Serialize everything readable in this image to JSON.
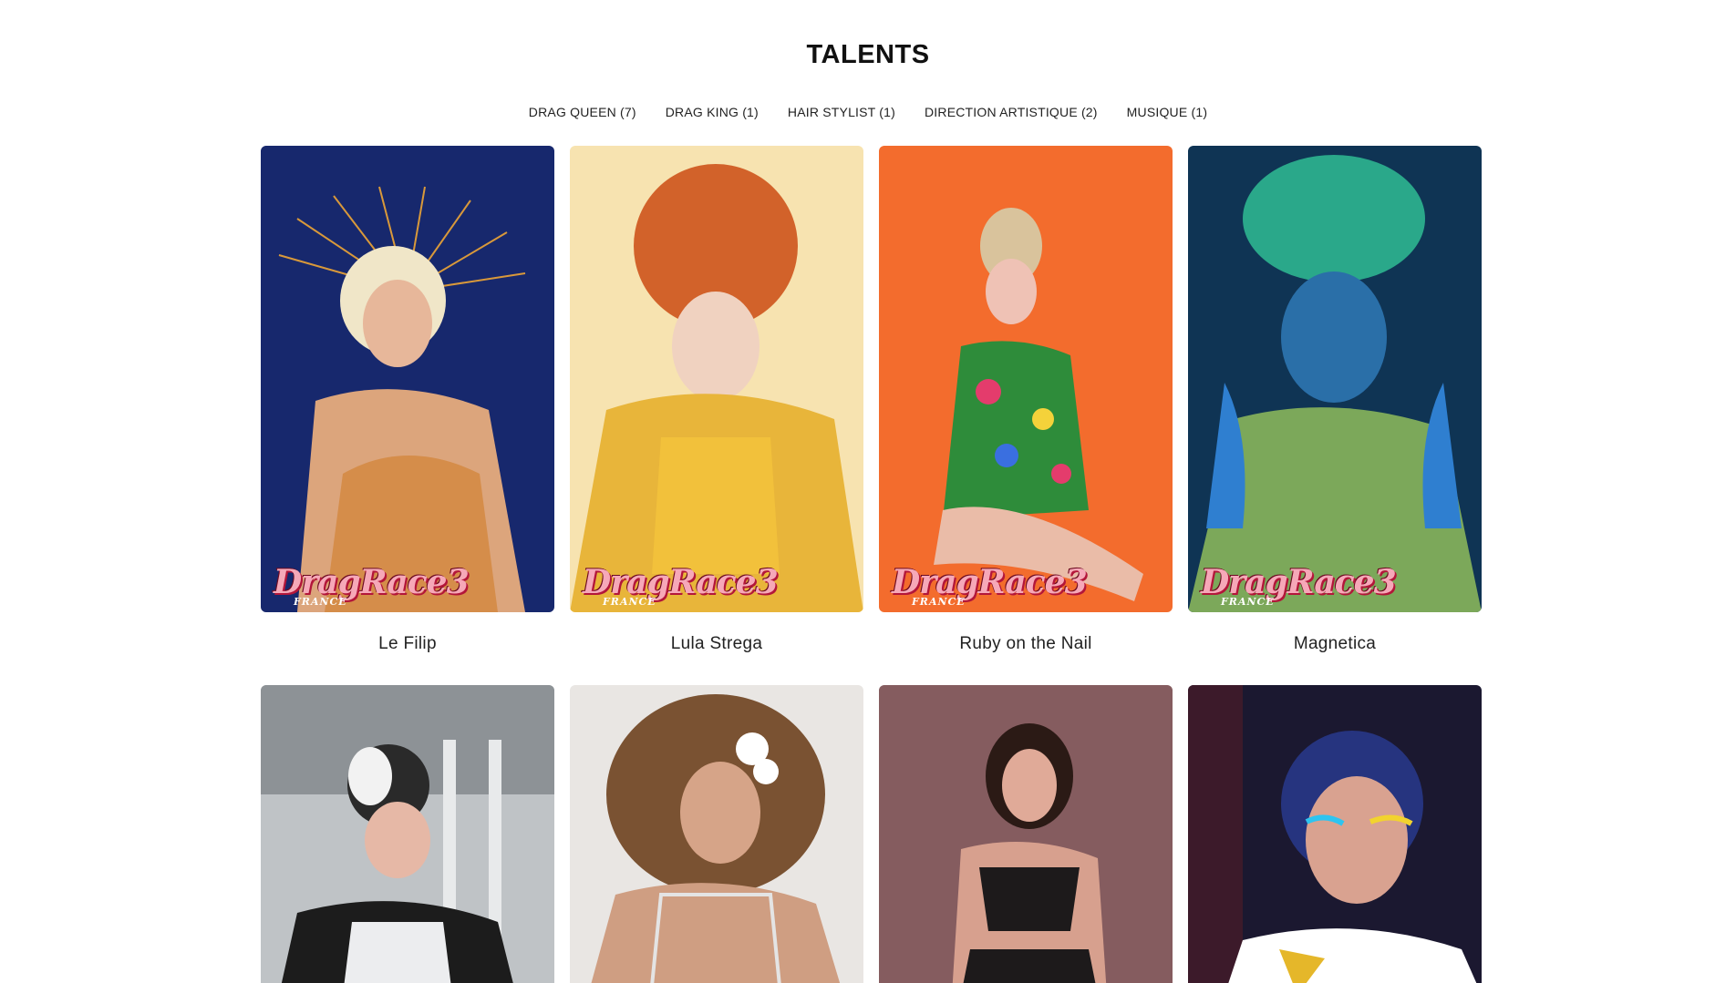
{
  "page": {
    "title": "TALENTS"
  },
  "filters": [
    "DRAG QUEEN (7)",
    "DRAG KING (1)",
    "HAIR STYLIST (1)",
    "DIRECTION ARTISTIQUE (2)",
    "MUSIQUE (1)"
  ],
  "talents": [
    {
      "name": "Le Filip",
      "badge": "DragRace3",
      "badge_sub": "FRANCE"
    },
    {
      "name": "Lula Strega",
      "badge": "DragRace3",
      "badge_sub": "FRANCE"
    },
    {
      "name": "Ruby on the Nail",
      "badge": "DragRace3",
      "badge_sub": "FRANCE"
    },
    {
      "name": "Magnetica",
      "badge": "DragRace3",
      "badge_sub": "FRANCE"
    }
  ]
}
